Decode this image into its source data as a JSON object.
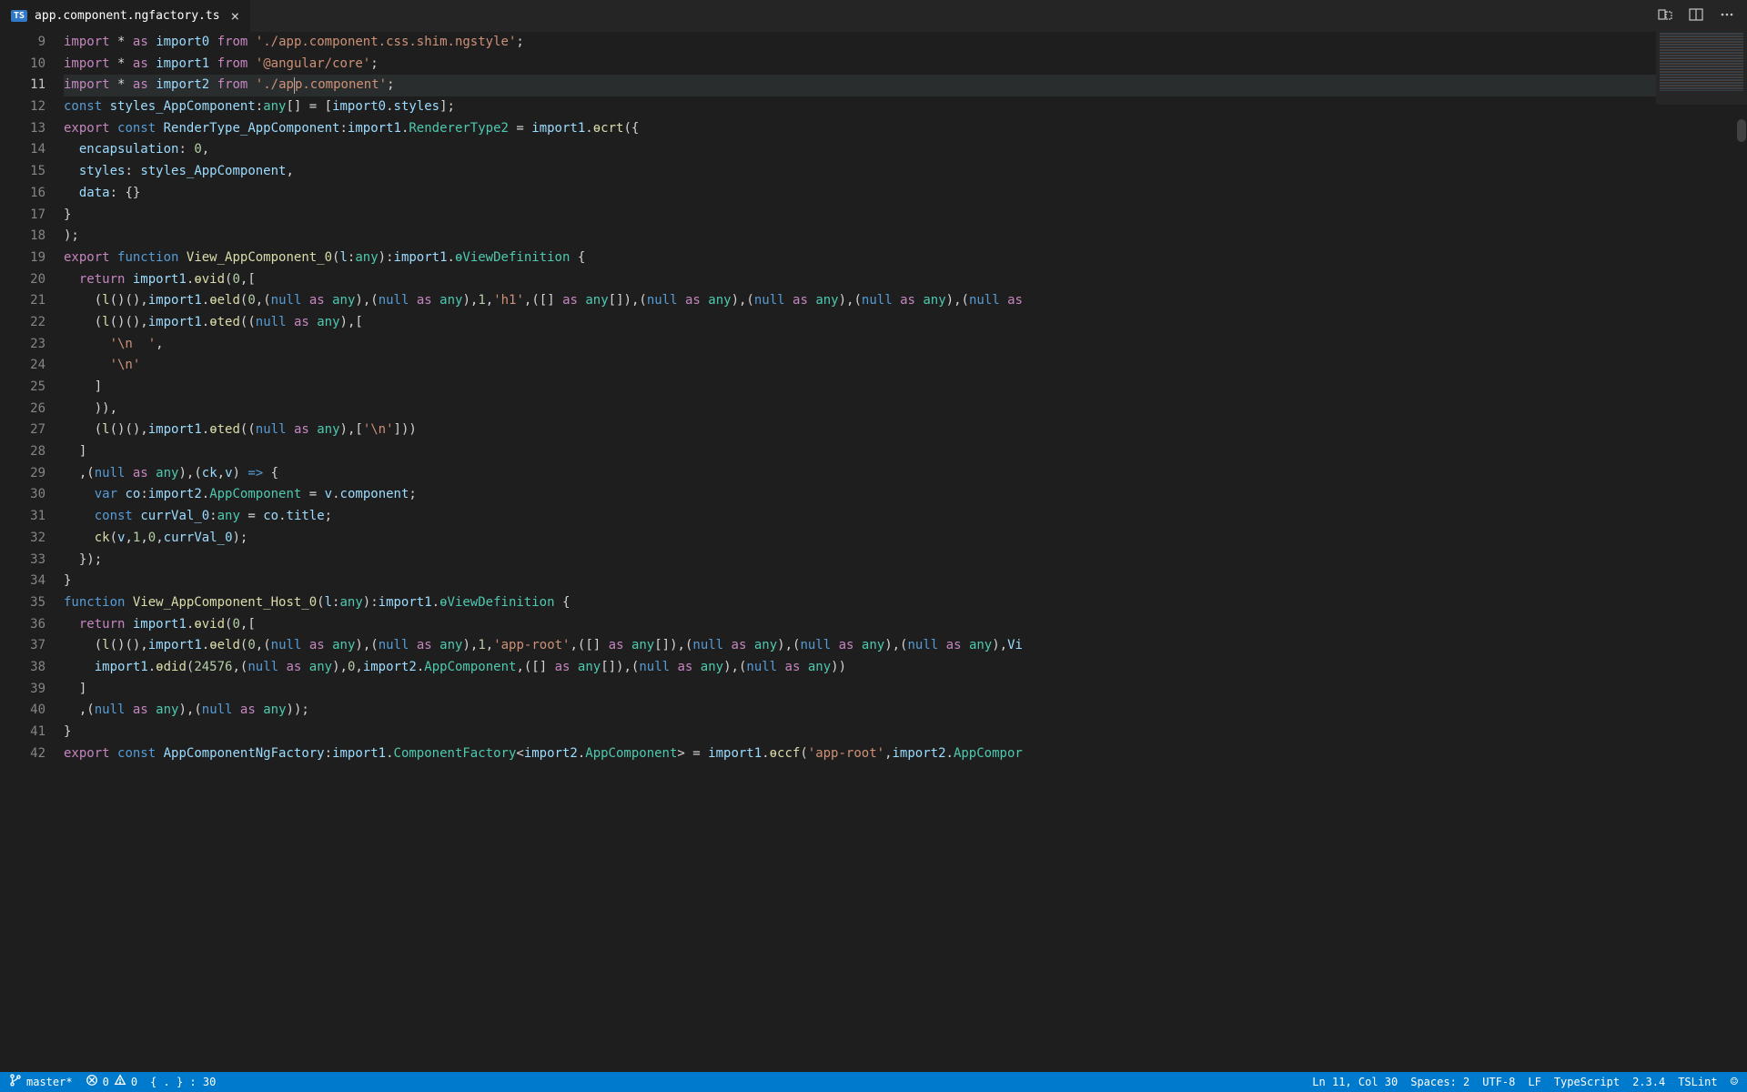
{
  "tab": {
    "label": "app.component.ngfactory.ts",
    "lang_badge": "TS"
  },
  "gutter": {
    "start": 9,
    "end": 42,
    "active": 11
  },
  "code_lines": [
    {
      "n": 9,
      "html": "<span class='kc'>import</span> <span class='p'>*</span> <span class='kc'>as</span> <span class='v'>import0</span> <span class='kc'>from</span> <span class='s'>'./app.component.css.shim.ngstyle'</span><span class='p'>;</span>"
    },
    {
      "n": 10,
      "html": "<span class='kc'>import</span> <span class='p'>*</span> <span class='kc'>as</span> <span class='v'>import1</span> <span class='kc'>from</span> <span class='s'>'@angular/core'</span><span class='p'>;</span>"
    },
    {
      "n": 11,
      "html": "<span class='kc'>import</span> <span class='p'>*</span> <span class='kc'>as</span> <span class='v'>import2</span> <span class='kc'>from</span> <span class='s'>'./ap<span class='cursor'></span>p.component'</span><span class='p'>;</span>",
      "active": true
    },
    {
      "n": 12,
      "html": "<span class='k'>const</span> <span class='v'>styles_AppComponent</span><span class='p'>:</span><span class='ty'>any</span><span class='p'>[] = [</span><span class='v'>import0</span><span class='p'>.</span><span class='v'>styles</span><span class='p'>];</span>"
    },
    {
      "n": 13,
      "html": "<span class='kc'>export</span> <span class='k'>const</span> <span class='v'>RenderType_AppComponent</span><span class='p'>:</span><span class='v'>import1</span><span class='p'>.</span><span class='ty'>RendererType2</span> <span class='p'>=</span> <span class='v'>import1</span><span class='p'>.</span><span class='fn'>ɵcrt</span><span class='p'>({</span>"
    },
    {
      "n": 14,
      "html": "  <span class='v'>encapsulation</span><span class='p'>:</span> <span class='n'>0</span><span class='p'>,</span>"
    },
    {
      "n": 15,
      "html": "  <span class='v'>styles</span><span class='p'>:</span> <span class='v'>styles_AppComponent</span><span class='p'>,</span>"
    },
    {
      "n": 16,
      "html": "  <span class='v'>data</span><span class='p'>:</span> <span class='p'>{}</span>"
    },
    {
      "n": 17,
      "html": "<span class='p'>}</span>"
    },
    {
      "n": 18,
      "html": "<span class='p'>);</span>"
    },
    {
      "n": 19,
      "html": "<span class='kc'>export</span> <span class='k'>function</span> <span class='fn'>View_AppComponent_0</span><span class='p'>(</span><span class='v'>l</span><span class='p'>:</span><span class='ty'>any</span><span class='p'>):</span><span class='v'>import1</span><span class='p'>.</span><span class='ty'>ɵViewDefinition</span> <span class='p'>{</span>"
    },
    {
      "n": 20,
      "html": "  <span class='kc'>return</span> <span class='v'>import1</span><span class='p'>.</span><span class='fn'>ɵvid</span><span class='p'>(</span><span class='n'>0</span><span class='p'>,[</span>"
    },
    {
      "n": 21,
      "html": "    <span class='p'>(</span><span class='fn'>l</span><span class='p'>()(),</span><span class='v'>import1</span><span class='p'>.</span><span class='fn'>ɵeld</span><span class='p'>(</span><span class='n'>0</span><span class='p'>,(</span><span class='k'>null</span> <span class='kc'>as</span> <span class='ty'>any</span><span class='p'>),(</span><span class='k'>null</span> <span class='kc'>as</span> <span class='ty'>any</span><span class='p'>),</span><span class='n'>1</span><span class='p'>,</span><span class='s'>'h1'</span><span class='p'>,([] </span><span class='kc'>as</span> <span class='ty'>any</span><span class='p'>[]),(</span><span class='k'>null</span> <span class='kc'>as</span> <span class='ty'>any</span><span class='p'>),(</span><span class='k'>null</span> <span class='kc'>as</span> <span class='ty'>any</span><span class='p'>),(</span><span class='k'>null</span> <span class='kc'>as</span> <span class='ty'>any</span><span class='p'>),(</span><span class='k'>null</span> <span class='kc'>as</span>"
    },
    {
      "n": 22,
      "html": "    <span class='p'>(</span><span class='fn'>l</span><span class='p'>()(),</span><span class='v'>import1</span><span class='p'>.</span><span class='fn'>ɵted</span><span class='p'>((</span><span class='k'>null</span> <span class='kc'>as</span> <span class='ty'>any</span><span class='p'>),[</span>"
    },
    {
      "n": 23,
      "html": "      <span class='s'>'\\n  '</span><span class='p'>,</span>"
    },
    {
      "n": 24,
      "html": "      <span class='s'>'\\n'</span>"
    },
    {
      "n": 25,
      "html": "    <span class='p'>]</span>"
    },
    {
      "n": 26,
      "html": "    <span class='p'>)),</span>"
    },
    {
      "n": 27,
      "html": "    <span class='p'>(</span><span class='fn'>l</span><span class='p'>()(),</span><span class='v'>import1</span><span class='p'>.</span><span class='fn'>ɵted</span><span class='p'>((</span><span class='k'>null</span> <span class='kc'>as</span> <span class='ty'>any</span><span class='p'>),[</span><span class='s'>'\\n'</span><span class='p'>]))</span>"
    },
    {
      "n": 28,
      "html": "  <span class='p'>]</span>"
    },
    {
      "n": 29,
      "html": "  <span class='p'>,(</span><span class='k'>null</span> <span class='kc'>as</span> <span class='ty'>any</span><span class='p'>),(</span><span class='v'>ck</span><span class='p'>,</span><span class='v'>v</span><span class='p'>)</span> <span class='k'>=&gt;</span> <span class='p'>{</span>"
    },
    {
      "n": 30,
      "html": "    <span class='k'>var</span> <span class='v'>co</span><span class='p'>:</span><span class='v'>import2</span><span class='p'>.</span><span class='ty'>AppComponent</span> <span class='p'>=</span> <span class='v'>v</span><span class='p'>.</span><span class='v'>component</span><span class='p'>;</span>"
    },
    {
      "n": 31,
      "html": "    <span class='k'>const</span> <span class='v'>currVal_0</span><span class='p'>:</span><span class='ty'>any</span> <span class='p'>=</span> <span class='v'>co</span><span class='p'>.</span><span class='v'>title</span><span class='p'>;</span>"
    },
    {
      "n": 32,
      "html": "    <span class='fn'>ck</span><span class='p'>(</span><span class='v'>v</span><span class='p'>,</span><span class='n'>1</span><span class='p'>,</span><span class='n'>0</span><span class='p'>,</span><span class='v'>currVal_0</span><span class='p'>);</span>"
    },
    {
      "n": 33,
      "html": "  <span class='p'>});</span>"
    },
    {
      "n": 34,
      "html": "<span class='p'>}</span>"
    },
    {
      "n": 35,
      "html": "<span class='k'>function</span> <span class='fn'>View_AppComponent_Host_0</span><span class='p'>(</span><span class='v'>l</span><span class='p'>:</span><span class='ty'>any</span><span class='p'>):</span><span class='v'>import1</span><span class='p'>.</span><span class='ty'>ɵViewDefinition</span> <span class='p'>{</span>"
    },
    {
      "n": 36,
      "html": "  <span class='kc'>return</span> <span class='v'>import1</span><span class='p'>.</span><span class='fn'>ɵvid</span><span class='p'>(</span><span class='n'>0</span><span class='p'>,[</span>"
    },
    {
      "n": 37,
      "html": "    <span class='p'>(</span><span class='fn'>l</span><span class='p'>()(),</span><span class='v'>import1</span><span class='p'>.</span><span class='fn'>ɵeld</span><span class='p'>(</span><span class='n'>0</span><span class='p'>,(</span><span class='k'>null</span> <span class='kc'>as</span> <span class='ty'>any</span><span class='p'>),(</span><span class='k'>null</span> <span class='kc'>as</span> <span class='ty'>any</span><span class='p'>),</span><span class='n'>1</span><span class='p'>,</span><span class='s'>'app-root'</span><span class='p'>,([] </span><span class='kc'>as</span> <span class='ty'>any</span><span class='p'>[]),(</span><span class='k'>null</span> <span class='kc'>as</span> <span class='ty'>any</span><span class='p'>),(</span><span class='k'>null</span> <span class='kc'>as</span> <span class='ty'>any</span><span class='p'>),(</span><span class='k'>null</span> <span class='kc'>as</span> <span class='ty'>any</span><span class='p'>),</span><span class='v'>Vi</span>"
    },
    {
      "n": 38,
      "html": "    <span class='v'>import1</span><span class='p'>.</span><span class='fn'>ɵdid</span><span class='p'>(</span><span class='n'>24576</span><span class='p'>,(</span><span class='k'>null</span> <span class='kc'>as</span> <span class='ty'>any</span><span class='p'>),</span><span class='n'>0</span><span class='p'>,</span><span class='v'>import2</span><span class='p'>.</span><span class='ty'>AppComponent</span><span class='p'>,([] </span><span class='kc'>as</span> <span class='ty'>any</span><span class='p'>[]),(</span><span class='k'>null</span> <span class='kc'>as</span> <span class='ty'>any</span><span class='p'>),(</span><span class='k'>null</span> <span class='kc'>as</span> <span class='ty'>any</span><span class='p'>))</span>"
    },
    {
      "n": 39,
      "html": "  <span class='p'>]</span>"
    },
    {
      "n": 40,
      "html": "  <span class='p'>,(</span><span class='k'>null</span> <span class='kc'>as</span> <span class='ty'>any</span><span class='p'>),(</span><span class='k'>null</span> <span class='kc'>as</span> <span class='ty'>any</span><span class='p'>));</span>"
    },
    {
      "n": 41,
      "html": "<span class='p'>}</span>"
    },
    {
      "n": 42,
      "html": "<span class='kc'>export</span> <span class='k'>const</span> <span class='v'>AppComponentNgFactory</span><span class='p'>:</span><span class='v'>import1</span><span class='p'>.</span><span class='ty'>ComponentFactory</span><span class='p'>&lt;</span><span class='v'>import2</span><span class='p'>.</span><span class='ty'>AppComponent</span><span class='p'>&gt; =</span> <span class='v'>import1</span><span class='p'>.</span><span class='fn'>ɵccf</span><span class='p'>(</span><span class='s'>'app-root'</span><span class='p'>,</span><span class='v'>import2</span><span class='p'>.</span><span class='ty'>AppCompor</span>"
    }
  ],
  "status": {
    "branch": "master*",
    "errors": "0",
    "warnings": "0",
    "bracket": "{ . } : 30",
    "position": "Ln 11, Col 30",
    "indent": "Spaces: 2",
    "encoding": "UTF-8",
    "eol": "LF",
    "language": "TypeScript",
    "version": "2.3.4",
    "lint": "TSLint"
  }
}
